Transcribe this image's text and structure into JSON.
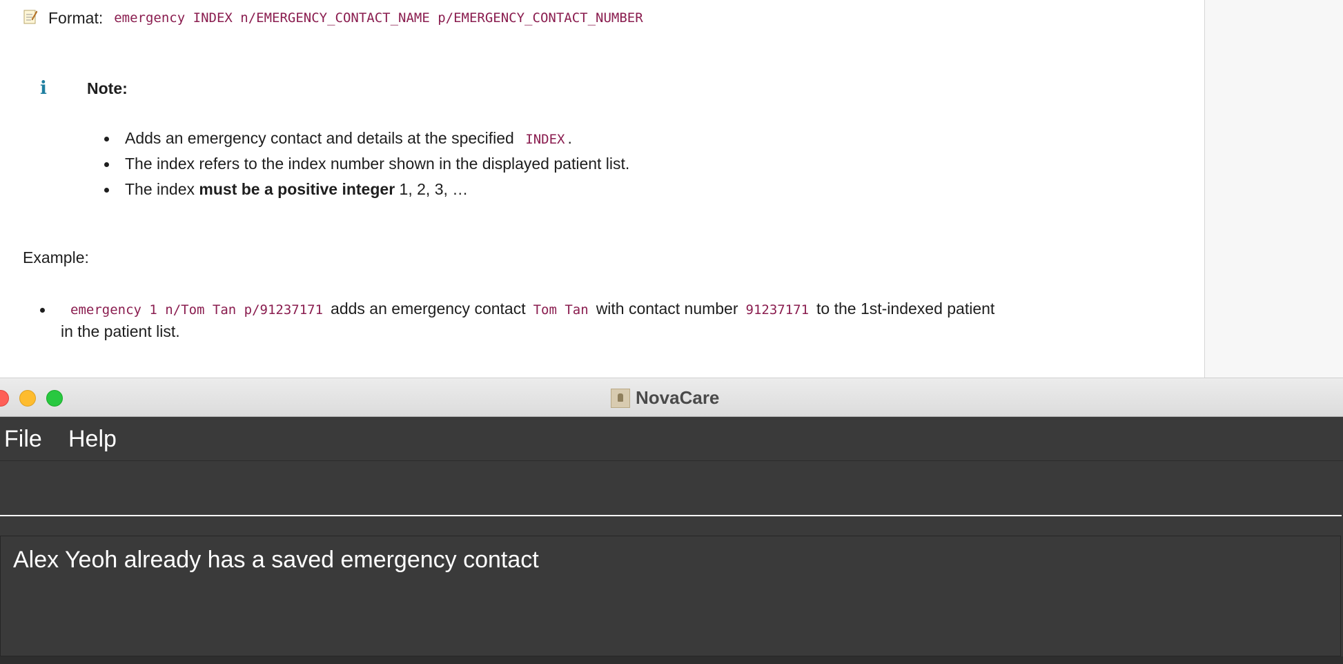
{
  "doc": {
    "format": {
      "label": "Format:",
      "command": "emergency INDEX n/EMERGENCY_CONTACT_NAME p/EMERGENCY_CONTACT_NUMBER"
    },
    "note": {
      "title": "Note:",
      "icon": "info-icon",
      "item1_text": "Adds an emergency contact and details at the specified",
      "item1_code": "INDEX",
      "item1_end": ".",
      "item2": "The index refers to the index number shown in the displayed patient list.",
      "item3_pre": "The index ",
      "item3_bold": "must be a positive integer",
      "item3_post": " 1, 2, 3, …"
    },
    "example": {
      "label": "Example:",
      "code_command": "emergency 1 n/Tom Tan p/91237171",
      "text1": "adds an emergency contact",
      "code_name": "Tom Tan",
      "text2": "with contact number",
      "code_number": "91237171",
      "text3": "to the 1st-indexed patient",
      "line2": "in the patient list."
    }
  },
  "app": {
    "window_title": "NovaCare",
    "menu": {
      "file": "File",
      "help": "Help"
    },
    "command_input": {
      "value": ""
    },
    "result": "Alex Yeoh already has a saved emergency contact"
  },
  "colors": {
    "code": "#8a1d4f",
    "app_background": "#3a3a3a",
    "info_icon": "#1f7fa0"
  }
}
